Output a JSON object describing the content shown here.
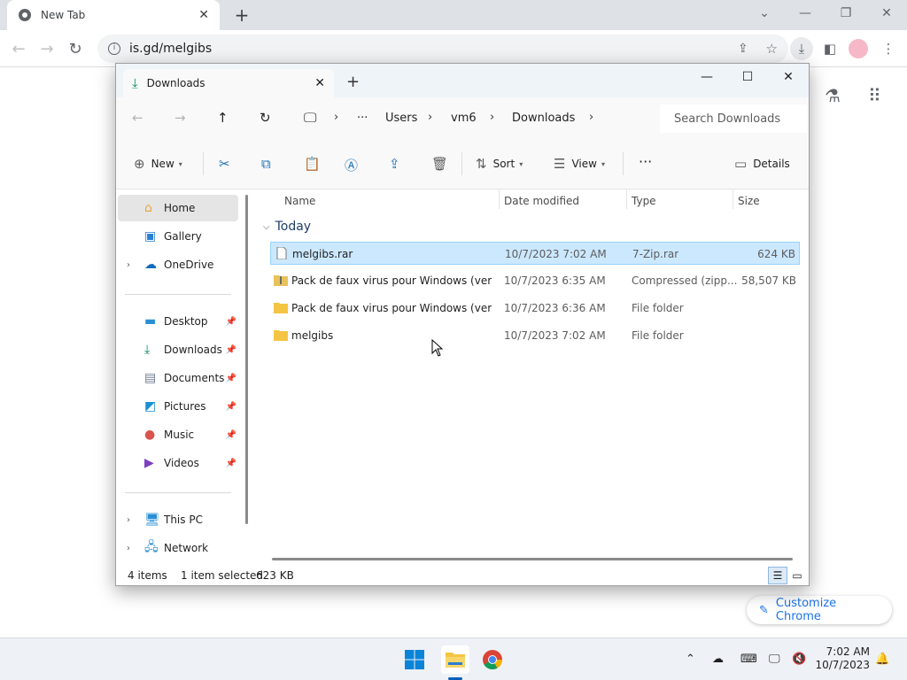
{
  "browser": {
    "tab_title": "New Tab",
    "url": "is.gd/melgibs",
    "customize_label": "Customize Chrome"
  },
  "explorer": {
    "tab_title": "Downloads",
    "breadcrumb": [
      "Users",
      "vm6",
      "Downloads"
    ],
    "search_placeholder": "Search Downloads",
    "commands": {
      "new": "New",
      "sort": "Sort",
      "view": "View",
      "details": "Details"
    },
    "nav": {
      "home": "Home",
      "gallery": "Gallery",
      "onedrive": "OneDrive",
      "desktop": "Desktop",
      "downloads": "Downloads",
      "documents": "Documents",
      "pictures": "Pictures",
      "music": "Music",
      "videos": "Videos",
      "thispc": "This PC",
      "network": "Network"
    },
    "columns": {
      "name": "Name",
      "date": "Date modified",
      "type": "Type",
      "size": "Size"
    },
    "group_label": "Today",
    "files": [
      {
        "name": "melgibs.rar",
        "date": "10/7/2023 7:02 AM",
        "type": "7-Zip.rar",
        "size": "624 KB",
        "icon": "file-icon",
        "selected": true
      },
      {
        "name": "Pack de faux virus pour Windows (versio...",
        "date": "10/7/2023 6:35 AM",
        "type": "Compressed (zipp...",
        "size": "58,507 KB",
        "icon": "zip-folder-icon",
        "selected": false
      },
      {
        "name": "Pack de faux virus pour Windows (versio...",
        "date": "10/7/2023 6:36 AM",
        "type": "File folder",
        "size": "",
        "icon": "folder-icon",
        "selected": false
      },
      {
        "name": "melgibs",
        "date": "10/7/2023 7:02 AM",
        "type": "File folder",
        "size": "",
        "icon": "folder-icon",
        "selected": false
      }
    ],
    "status": {
      "count": "4 items",
      "selection": "1 item selected",
      "size": "623 KB"
    }
  },
  "taskbar": {
    "time": "7:02 AM",
    "date": "10/7/2023"
  },
  "colors": {
    "accent": "#005fb8",
    "selection": "#cce8ff",
    "link": "#1a73e8"
  }
}
